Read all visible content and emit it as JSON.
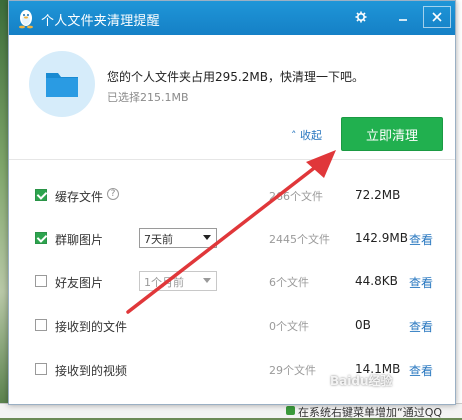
{
  "dialog": {
    "title": "个人文件夹清理提醒",
    "settings_icon": "gear-icon",
    "minimize_icon": "minimize-icon",
    "close_icon": "close-icon",
    "accent_color": "#1a8bd2"
  },
  "summary": {
    "message": "您的个人文件夹占用295.2MB，快清理一下吧。",
    "selected": "已选择215.1MB",
    "collapse_label": "收起",
    "clean_button": "立即清理",
    "clean_button_color": "#21b04f"
  },
  "items": [
    {
      "label": "缓存文件",
      "checked": true,
      "has_help": true,
      "select": null,
      "count": "266个文件",
      "size": "72.2MB",
      "view": ""
    },
    {
      "label": "群聊图片",
      "checked": true,
      "has_help": false,
      "select": {
        "value": "7天前",
        "disabled": false
      },
      "count": "2445个文件",
      "size": "142.9MB",
      "view": "查看"
    },
    {
      "label": "好友图片",
      "checked": false,
      "has_help": false,
      "select": {
        "value": "1个月前",
        "disabled": true
      },
      "count": "6个文件",
      "size": "44.8KB",
      "view": "查看"
    },
    {
      "label": "接收到的文件",
      "checked": false,
      "has_help": false,
      "select": null,
      "count": "0个文件",
      "size": "0B",
      "view": "查看"
    },
    {
      "label": "接收到的视频",
      "checked": false,
      "has_help": false,
      "select": null,
      "count": "29个文件",
      "size": "14.1MB",
      "view": "查看"
    }
  ],
  "background": {
    "bottom_text": "在系统右键菜单增加“通过QQ"
  },
  "watermark": "Baidu经验"
}
